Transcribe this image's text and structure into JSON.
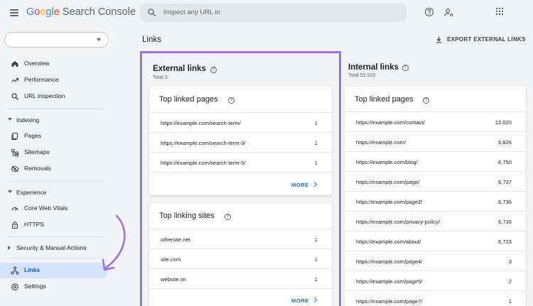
{
  "app": {
    "logo_word": "Google",
    "product": "Search Console"
  },
  "search": {
    "placeholder": "Inspect any URL in"
  },
  "sidebar": {
    "items": [
      {
        "label": "Overview",
        "icon": "home-icon"
      },
      {
        "label": "Performance",
        "icon": "trending-up-icon"
      },
      {
        "label": "URL inspection",
        "icon": "search-icon"
      }
    ],
    "sections": [
      {
        "label": "Indexing",
        "expanded": true,
        "items": [
          {
            "label": "Pages",
            "icon": "pages-icon"
          },
          {
            "label": "Sitemaps",
            "icon": "sitemap-icon"
          },
          {
            "label": "Removals",
            "icon": "removals-icon"
          }
        ]
      },
      {
        "label": "Experience",
        "expanded": true,
        "items": [
          {
            "label": "Core Web Vitals",
            "icon": "speed-icon"
          },
          {
            "label": "HTTPS",
            "icon": "lock-icon"
          }
        ]
      },
      {
        "label": "Security & Manual Actions",
        "expanded": false,
        "items": []
      }
    ],
    "bottom_items": [
      {
        "label": "Links",
        "icon": "links-icon",
        "active": true
      },
      {
        "label": "Settings",
        "icon": "gear-icon"
      }
    ]
  },
  "page": {
    "title": "Links",
    "export_label": "EXPORT EXTERNAL LINKS"
  },
  "external": {
    "title": "External links",
    "total": "Total 3",
    "top_linked_pages": {
      "title": "Top linked pages",
      "rows": [
        {
          "url": "https://example.com/search-term/",
          "count": "1"
        },
        {
          "url": "https://example.com/search-term-3/",
          "count": "1"
        },
        {
          "url": "https://example.com/search-term-5/",
          "count": "1"
        }
      ],
      "more": "MORE"
    },
    "top_linking_sites": {
      "title": "Top linking sites",
      "rows": [
        {
          "url": "othersite.net",
          "count": "1"
        },
        {
          "url": "site.com",
          "count": "1"
        },
        {
          "url": "website.im",
          "count": "1"
        }
      ],
      "more": "MORE"
    }
  },
  "internal": {
    "title": "Internal links",
    "total": "Total 52,533",
    "top_linked_pages": {
      "title": "Top linked pages",
      "rows": [
        {
          "url": "https://example.com/contact/",
          "count": "12,020"
        },
        {
          "url": "https://example.com/",
          "count": "6,826"
        },
        {
          "url": "https://example.com/blog/",
          "count": "6,750"
        },
        {
          "url": "https://example.com/page/",
          "count": "6,737"
        },
        {
          "url": "https://example.com/page2/",
          "count": "6,736"
        },
        {
          "url": "https://example.com/privacy-policy/",
          "count": "6,735"
        },
        {
          "url": "https://example.com/about/",
          "count": "6,723"
        },
        {
          "url": "https://example.com/page4/",
          "count": "3"
        },
        {
          "url": "https://example.com/page5/",
          "count": "2"
        },
        {
          "url": "https://example.com/page7/",
          "count": "1"
        }
      ]
    }
  },
  "colors": {
    "highlight_border": "#9b72e0",
    "active_nav_bg": "#d3e3fd",
    "link_blue": "#1a73e8"
  }
}
